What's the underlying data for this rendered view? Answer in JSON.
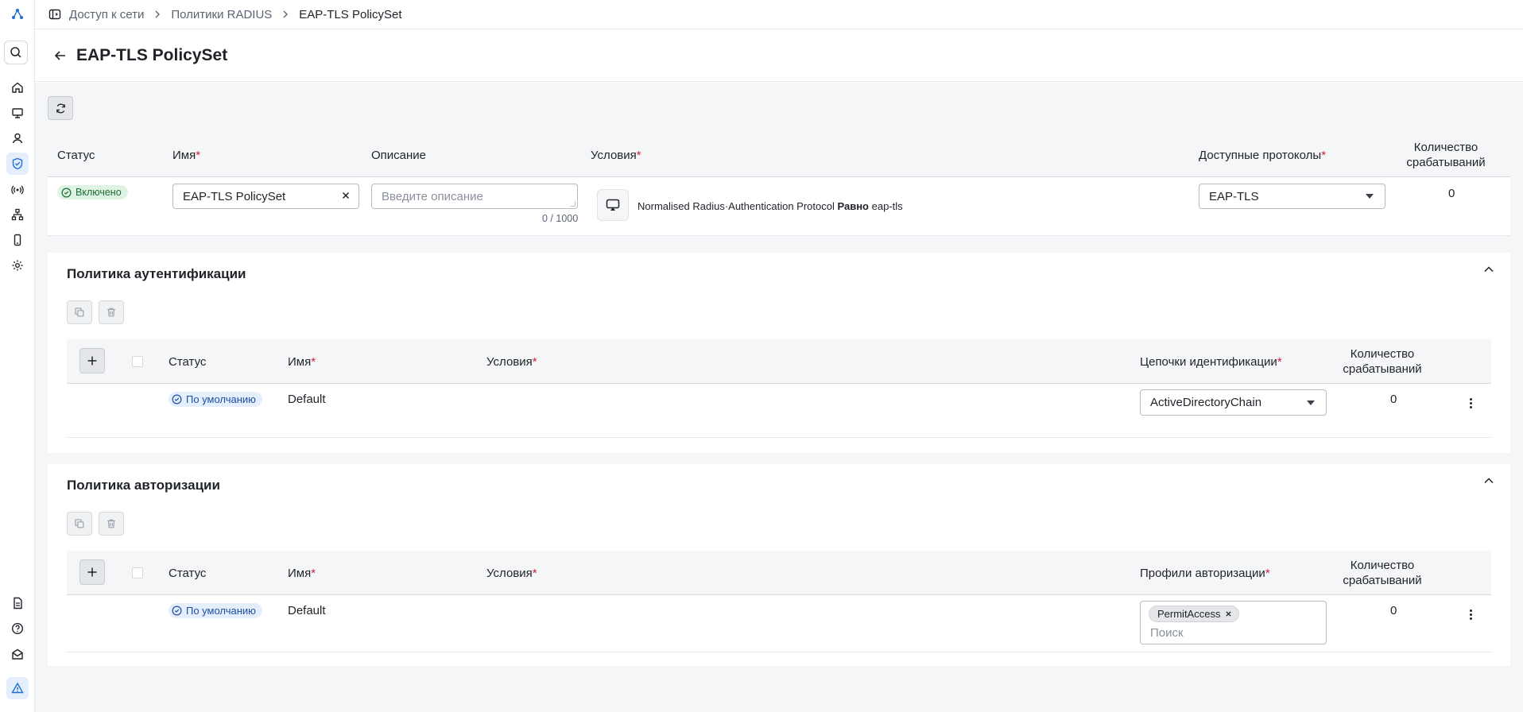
{
  "breadcrumb": {
    "items": [
      "Доступ к сети",
      "Политики RADIUS",
      "EAP-TLS PolicySet"
    ]
  },
  "page": {
    "title": "EAP-TLS PolicySet"
  },
  "policy_set": {
    "headers": {
      "status": "Статус",
      "name": "Имя",
      "description": "Описание",
      "conditions": "Условия",
      "protocols": "Доступные протоколы",
      "hits": "Количество срабатываний"
    },
    "required_mark": "*",
    "row": {
      "status": "Включено",
      "name_value": "EAP-TLS PolicySet",
      "description_placeholder": "Введите описание",
      "description_counter": "0 / 1000",
      "condition_attr": "Normalised Radius·Authentication Protocol",
      "condition_op": "Равно",
      "condition_value": "eap-tls",
      "protocol": "EAP-TLS",
      "hits": "0"
    }
  },
  "auth_section": {
    "title": "Политика аутентификации",
    "headers": {
      "status": "Статус",
      "name": "Имя",
      "conditions": "Условия",
      "chains": "Цепочки идентификации",
      "hits": "Количество срабатываний"
    },
    "row": {
      "status": "По умолчанию",
      "name": "Default",
      "chain": "ActiveDirectoryChain",
      "hits": "0"
    }
  },
  "authz_section": {
    "title": "Политика авторизации",
    "headers": {
      "status": "Статус",
      "name": "Имя",
      "conditions": "Условия",
      "profiles": "Профили авторизации",
      "hits": "Количество срабатываний"
    },
    "row": {
      "status": "По умолчанию",
      "name": "Default",
      "profile_chip": "PermitAccess",
      "search_placeholder": "Поиск",
      "hits": "0"
    }
  },
  "colors": {
    "accent": "#1f6fd6",
    "success_bg": "#dff3e4",
    "success_text": "#1c6b34",
    "required": "#c7243a"
  }
}
